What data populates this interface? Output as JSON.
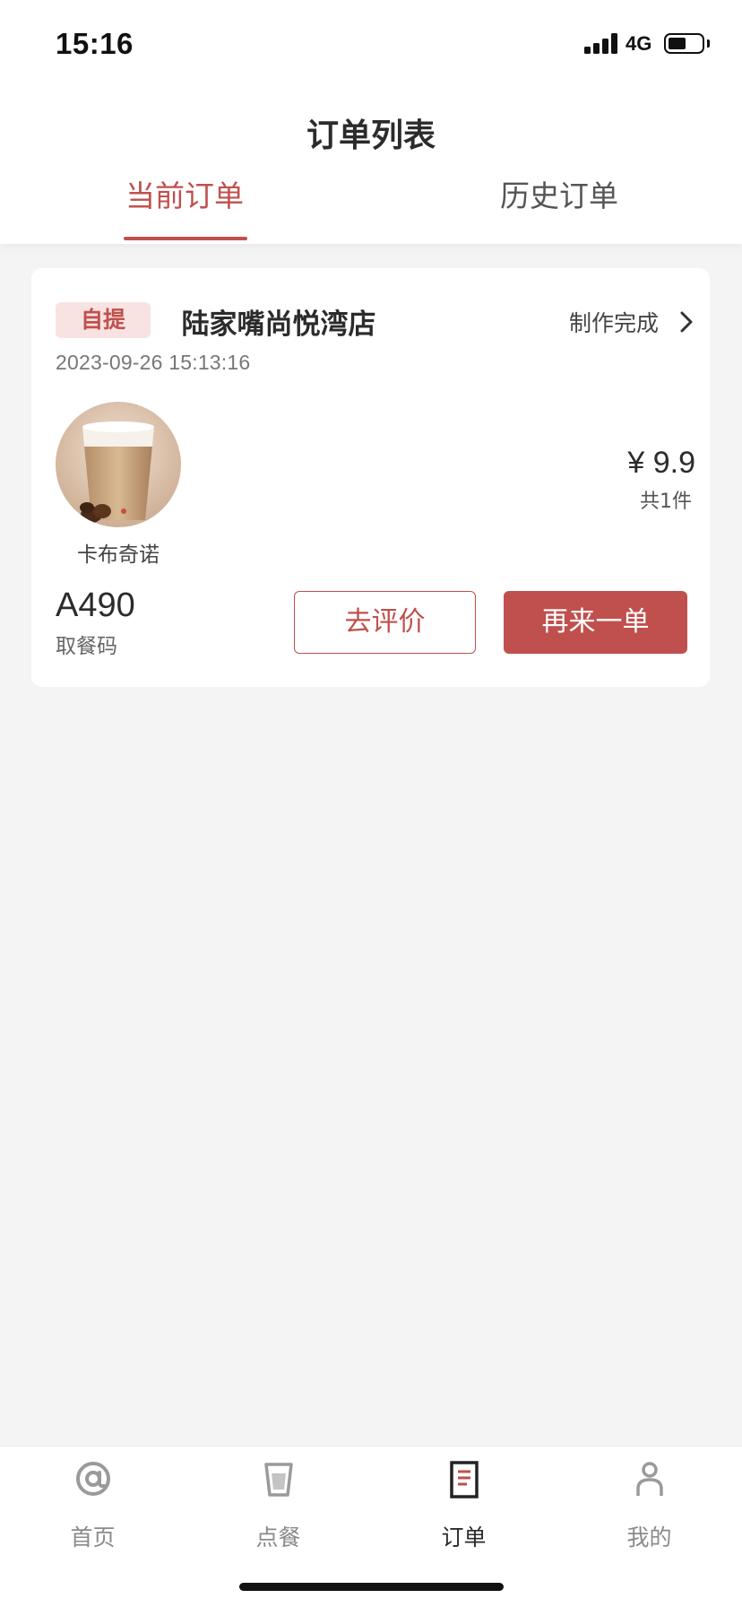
{
  "status_bar": {
    "time": "15:16",
    "network": "4G"
  },
  "header": {
    "title": "订单列表",
    "tabs": [
      {
        "label": "当前订单",
        "active": true
      },
      {
        "label": "历史订单",
        "active": false
      }
    ]
  },
  "order": {
    "pickup_type": "自提",
    "store_name": "陆家嘴尚悦湾店",
    "status": "制作完成",
    "time": "2023-09-26 15:13:16",
    "product_name": "卡布奇诺",
    "price": "¥ 9.9",
    "item_count": "共1件",
    "pickup_code": "A490",
    "pickup_code_label": "取餐码",
    "review_button": "去评价",
    "reorder_button": "再来一单"
  },
  "bottom_nav": {
    "items": [
      {
        "label": "首页",
        "icon": "at-icon",
        "active": false
      },
      {
        "label": "点餐",
        "icon": "cup-icon",
        "active": false
      },
      {
        "label": "订单",
        "icon": "receipt-icon",
        "active": true
      },
      {
        "label": "我的",
        "icon": "person-icon",
        "active": false
      }
    ]
  },
  "colors": {
    "accent": "#c0504d",
    "background": "#f4f4f5",
    "badge_background": "#f8e3e2"
  }
}
